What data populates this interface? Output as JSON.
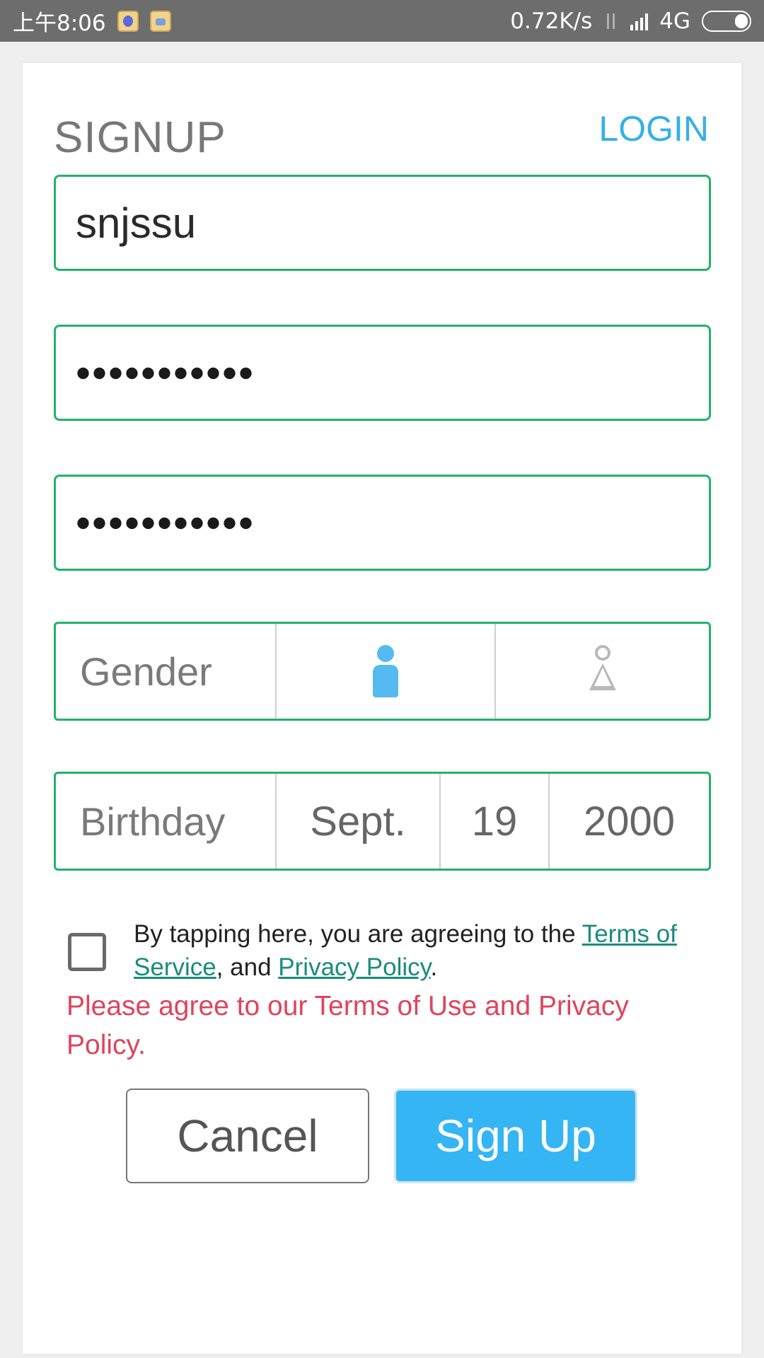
{
  "status_bar": {
    "time": "上午8:06",
    "net_speed": "0.72K/s",
    "network": "4G"
  },
  "form": {
    "title": "SIGNUP",
    "login_link": "LOGIN",
    "username_value": "snjssu",
    "password_mask": "•••••••••••",
    "confirm_password_mask": "•••••••••••",
    "gender_label": "Gender",
    "gender_selected": "male",
    "birthday_label": "Birthday",
    "birthday_month": "Sept.",
    "birthday_day": "19",
    "birthday_year": "2000"
  },
  "terms": {
    "prefix": "By tapping here, you are agreeing to the ",
    "terms_link": "Terms of Service",
    "middle": ", and ",
    "privacy_link": "Privacy Policy",
    "suffix": "."
  },
  "error_message": "Please agree to our Terms of Use and Privacy Policy.",
  "buttons": {
    "cancel": "Cancel",
    "signup": "Sign Up"
  },
  "colors": {
    "accent_blue": "#35b5f3",
    "field_border_green": "#23b26b",
    "error_red": "#e0435c",
    "link_teal": "#1a8c7c"
  }
}
